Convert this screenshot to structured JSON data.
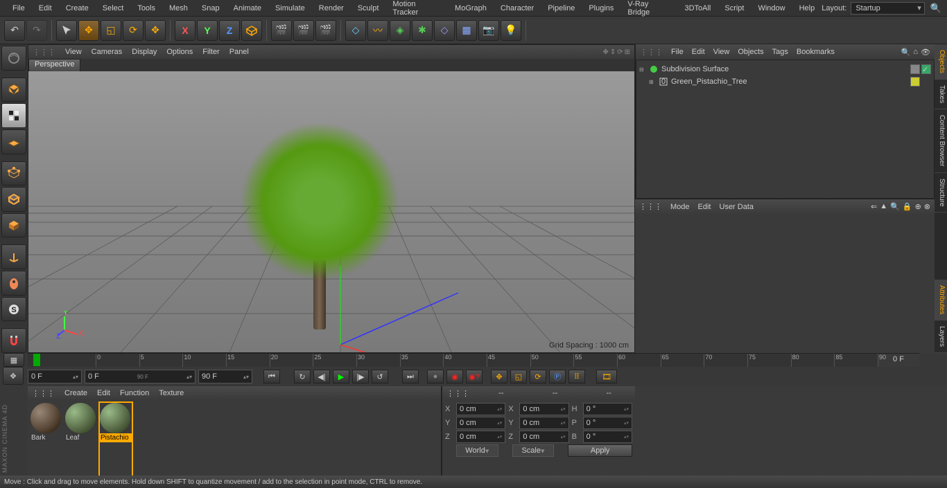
{
  "menus": {
    "file": "File",
    "edit": "Edit",
    "create": "Create",
    "select": "Select",
    "tools": "Tools",
    "mesh": "Mesh",
    "snap": "Snap",
    "animate": "Animate",
    "simulate": "Simulate",
    "render": "Render",
    "sculpt": "Sculpt",
    "motionTracker": "Motion Tracker",
    "mograph": "MoGraph",
    "character": "Character",
    "pipeline": "Pipeline",
    "plugins": "Plugins",
    "vray": "V-Ray Bridge",
    "tdtoall": "3DToAll",
    "script": "Script",
    "window": "Window",
    "help": "Help"
  },
  "layout": {
    "label": "Layout:",
    "value": "Startup"
  },
  "viewport": {
    "menus": {
      "view": "View",
      "cameras": "Cameras",
      "display": "Display",
      "options": "Options",
      "filter": "Filter",
      "panel": "Panel"
    },
    "tab": "Perspective",
    "gridSpacing": "Grid Spacing : 1000 cm"
  },
  "objects": {
    "menus": {
      "file": "File",
      "edit": "Edit",
      "view": "View",
      "objects": "Objects",
      "tags": "Tags",
      "bookmarks": "Bookmarks"
    },
    "tree": [
      {
        "name": "Subdivision Surface",
        "indent": 0
      },
      {
        "name": "Green_Pistachio_Tree",
        "indent": 1
      }
    ]
  },
  "attributes": {
    "menus": {
      "mode": "Mode",
      "edit": "Edit",
      "userData": "User Data"
    }
  },
  "sideTabs": {
    "objects": "Objects",
    "takes": "Takes",
    "content": "Content Browser",
    "structure": "Structure",
    "attributes": "Attributes",
    "layers": "Layers"
  },
  "timeline": {
    "frameLabels": [
      "0",
      "5",
      "10",
      "15",
      "20",
      "25",
      "30",
      "35",
      "40",
      "45",
      "50",
      "55",
      "60",
      "65",
      "70",
      "75",
      "80",
      "85",
      "90"
    ],
    "currentFrame": "0 F",
    "startFrame": "0 F",
    "rangeStart": "0 F",
    "rangeEnd": "90 F",
    "endFrame": "90 F"
  },
  "materials": {
    "menus": {
      "create": "Create",
      "edit": "Edit",
      "function": "Function",
      "texture": "Texture"
    },
    "items": [
      {
        "name": "Bark"
      },
      {
        "name": "Leaf"
      },
      {
        "name": "Pistachio",
        "selected": true
      }
    ]
  },
  "coords": {
    "header1": "--",
    "header2": "--",
    "header3": "--",
    "x": "X",
    "y": "Y",
    "z": "Z",
    "val": "0 cm",
    "h": "H",
    "p": "P",
    "b": "B",
    "ang": "0 °",
    "world": "World",
    "scale": "Scale",
    "apply": "Apply"
  },
  "status": "Move : Click and drag to move elements. Hold down SHIFT to quantize movement / add to the selection in point mode, CTRL to remove.",
  "brand": "MAXON CINEMA 4D"
}
